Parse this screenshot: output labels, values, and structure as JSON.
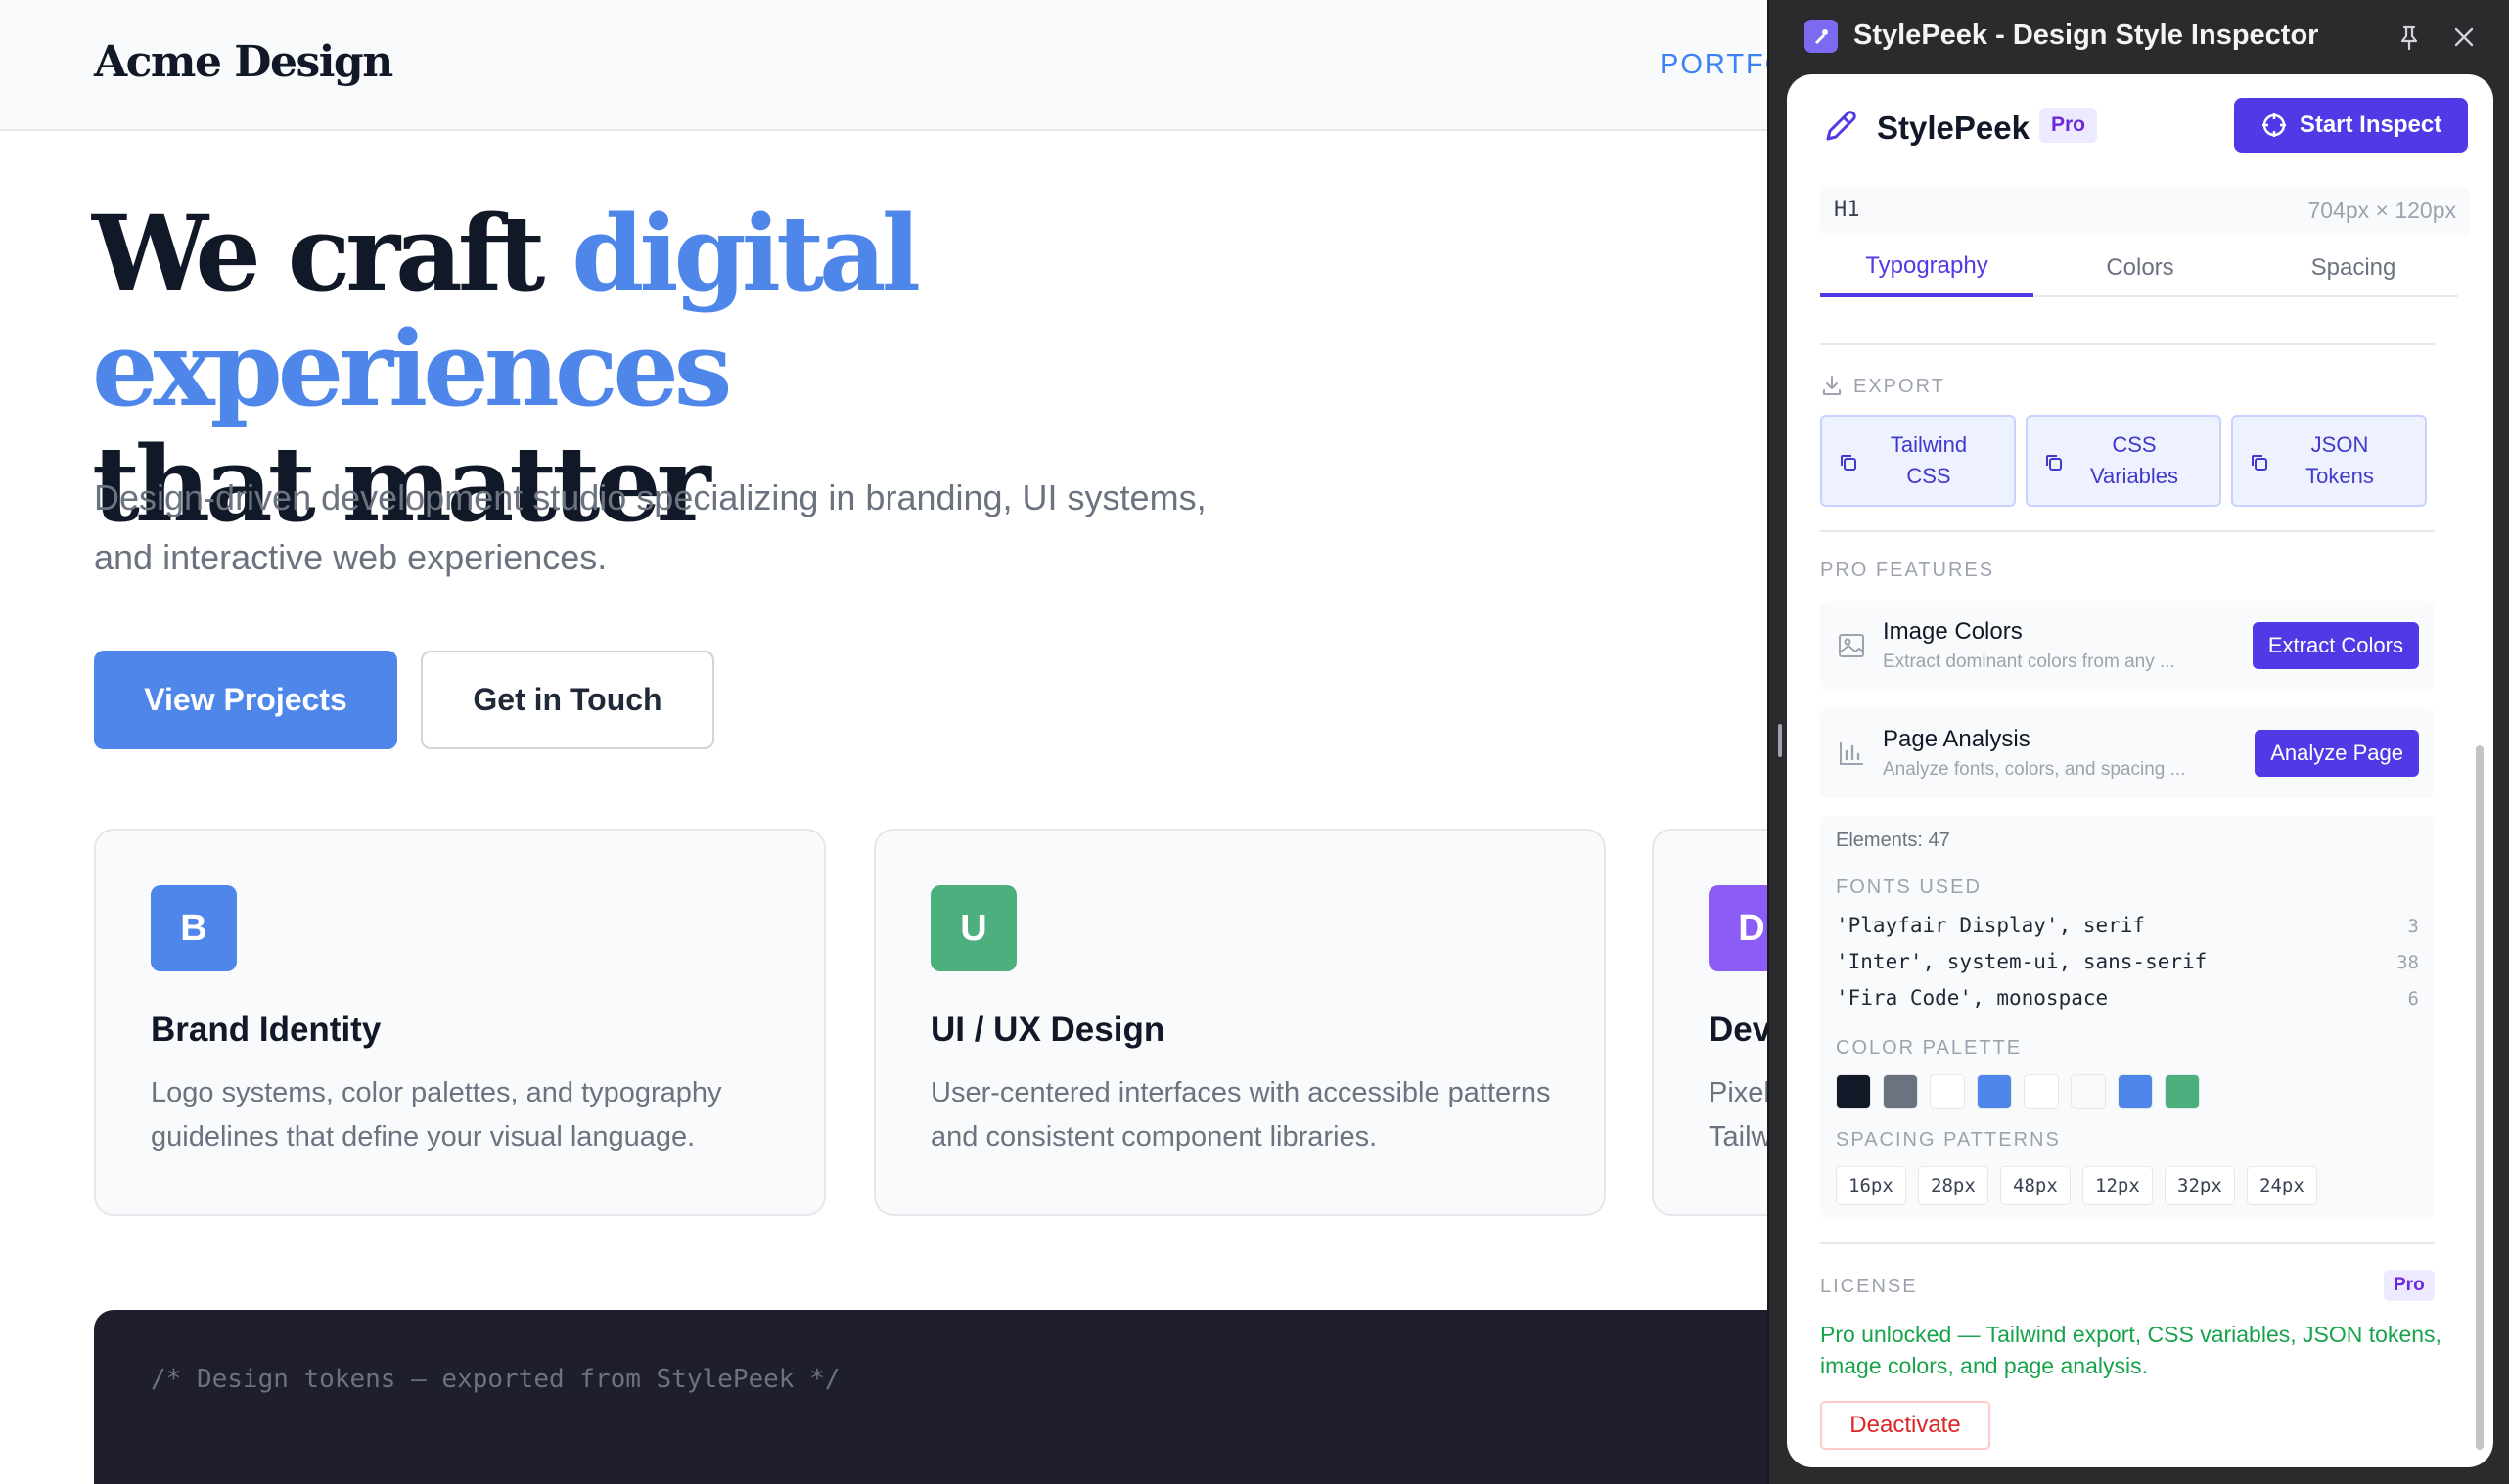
{
  "site": {
    "logo": "Acme Design",
    "nav_link": "PORTFO",
    "hero_title_1": "We craft",
    "hero_title_accent": "digital experiences",
    "hero_title_2": "that matter",
    "hero_subtitle": "Design-driven development studio specializing in branding, UI systems, and interactive web experiences.",
    "primary_button": "View Projects",
    "secondary_button": "Get in Touch",
    "cards": [
      {
        "icon_letter": "B",
        "icon_color": "#4f86ea",
        "title": "Brand Identity",
        "desc": "Logo systems, color palettes, and typography guidelines that define your visual language."
      },
      {
        "icon_letter": "U",
        "icon_color": "#4caf7d",
        "title": "UI / UX Design",
        "desc": "User-centered interfaces with accessible patterns and consistent component libraries."
      },
      {
        "icon_letter": "D",
        "icon_color": "#8b5cf6",
        "title": "Dev",
        "desc": "Pixel Tailw"
      }
    ],
    "code_comment": "/* Design tokens — exported from StylePeek */"
  },
  "extension": {
    "window_title": "StylePeek - Design Style Inspector",
    "brand": "StylePeek",
    "brand_badge": "Pro",
    "start_button": "Start Inspect",
    "selected_tag": "H1",
    "selected_size": "704px × 120px",
    "tabs": [
      {
        "label": "Typography",
        "active": true
      },
      {
        "label": "Colors",
        "active": false
      },
      {
        "label": "Spacing",
        "active": false
      }
    ],
    "export_label": "EXPORT",
    "export_buttons": [
      "Tailwind CSS",
      "CSS Variables",
      "JSON Tokens"
    ],
    "pro_label": "PRO FEATURES",
    "pro_features": [
      {
        "title": "Image Colors",
        "desc": "Extract dominant colors from any ...",
        "button": "Extract Colors",
        "icon": "image-icon"
      },
      {
        "title": "Page Analysis",
        "desc": "Analyze fonts, colors, and spacing ...",
        "button": "Analyze Page",
        "icon": "bar-chart-icon"
      }
    ],
    "analysis": {
      "elements": "Elements: 47",
      "fonts_label": "FONTS USED",
      "fonts": [
        {
          "name": "'Playfair Display', serif",
          "count": "3"
        },
        {
          "name": "'Inter', system-ui, sans-serif",
          "count": "38"
        },
        {
          "name": "'Fira Code', monospace",
          "count": "6"
        }
      ],
      "palette_label": "COLOR PALETTE",
      "palette": [
        "#111827",
        "#6b7280",
        "#ffffff",
        "#4f86ea",
        "#ffffff",
        "#f9fafb",
        "#4f86ea",
        "#4caf7d"
      ],
      "spacing_label": "SPACING PATTERNS",
      "spacing": [
        "16px",
        "28px",
        "48px",
        "12px",
        "32px",
        "24px"
      ]
    },
    "license_label": "LICENSE",
    "license_badge": "Pro",
    "license_text": "Pro unlocked — Tailwind export, CSS variables, JSON tokens, image colors, and page analysis.",
    "deactivate_button": "Deactivate"
  }
}
